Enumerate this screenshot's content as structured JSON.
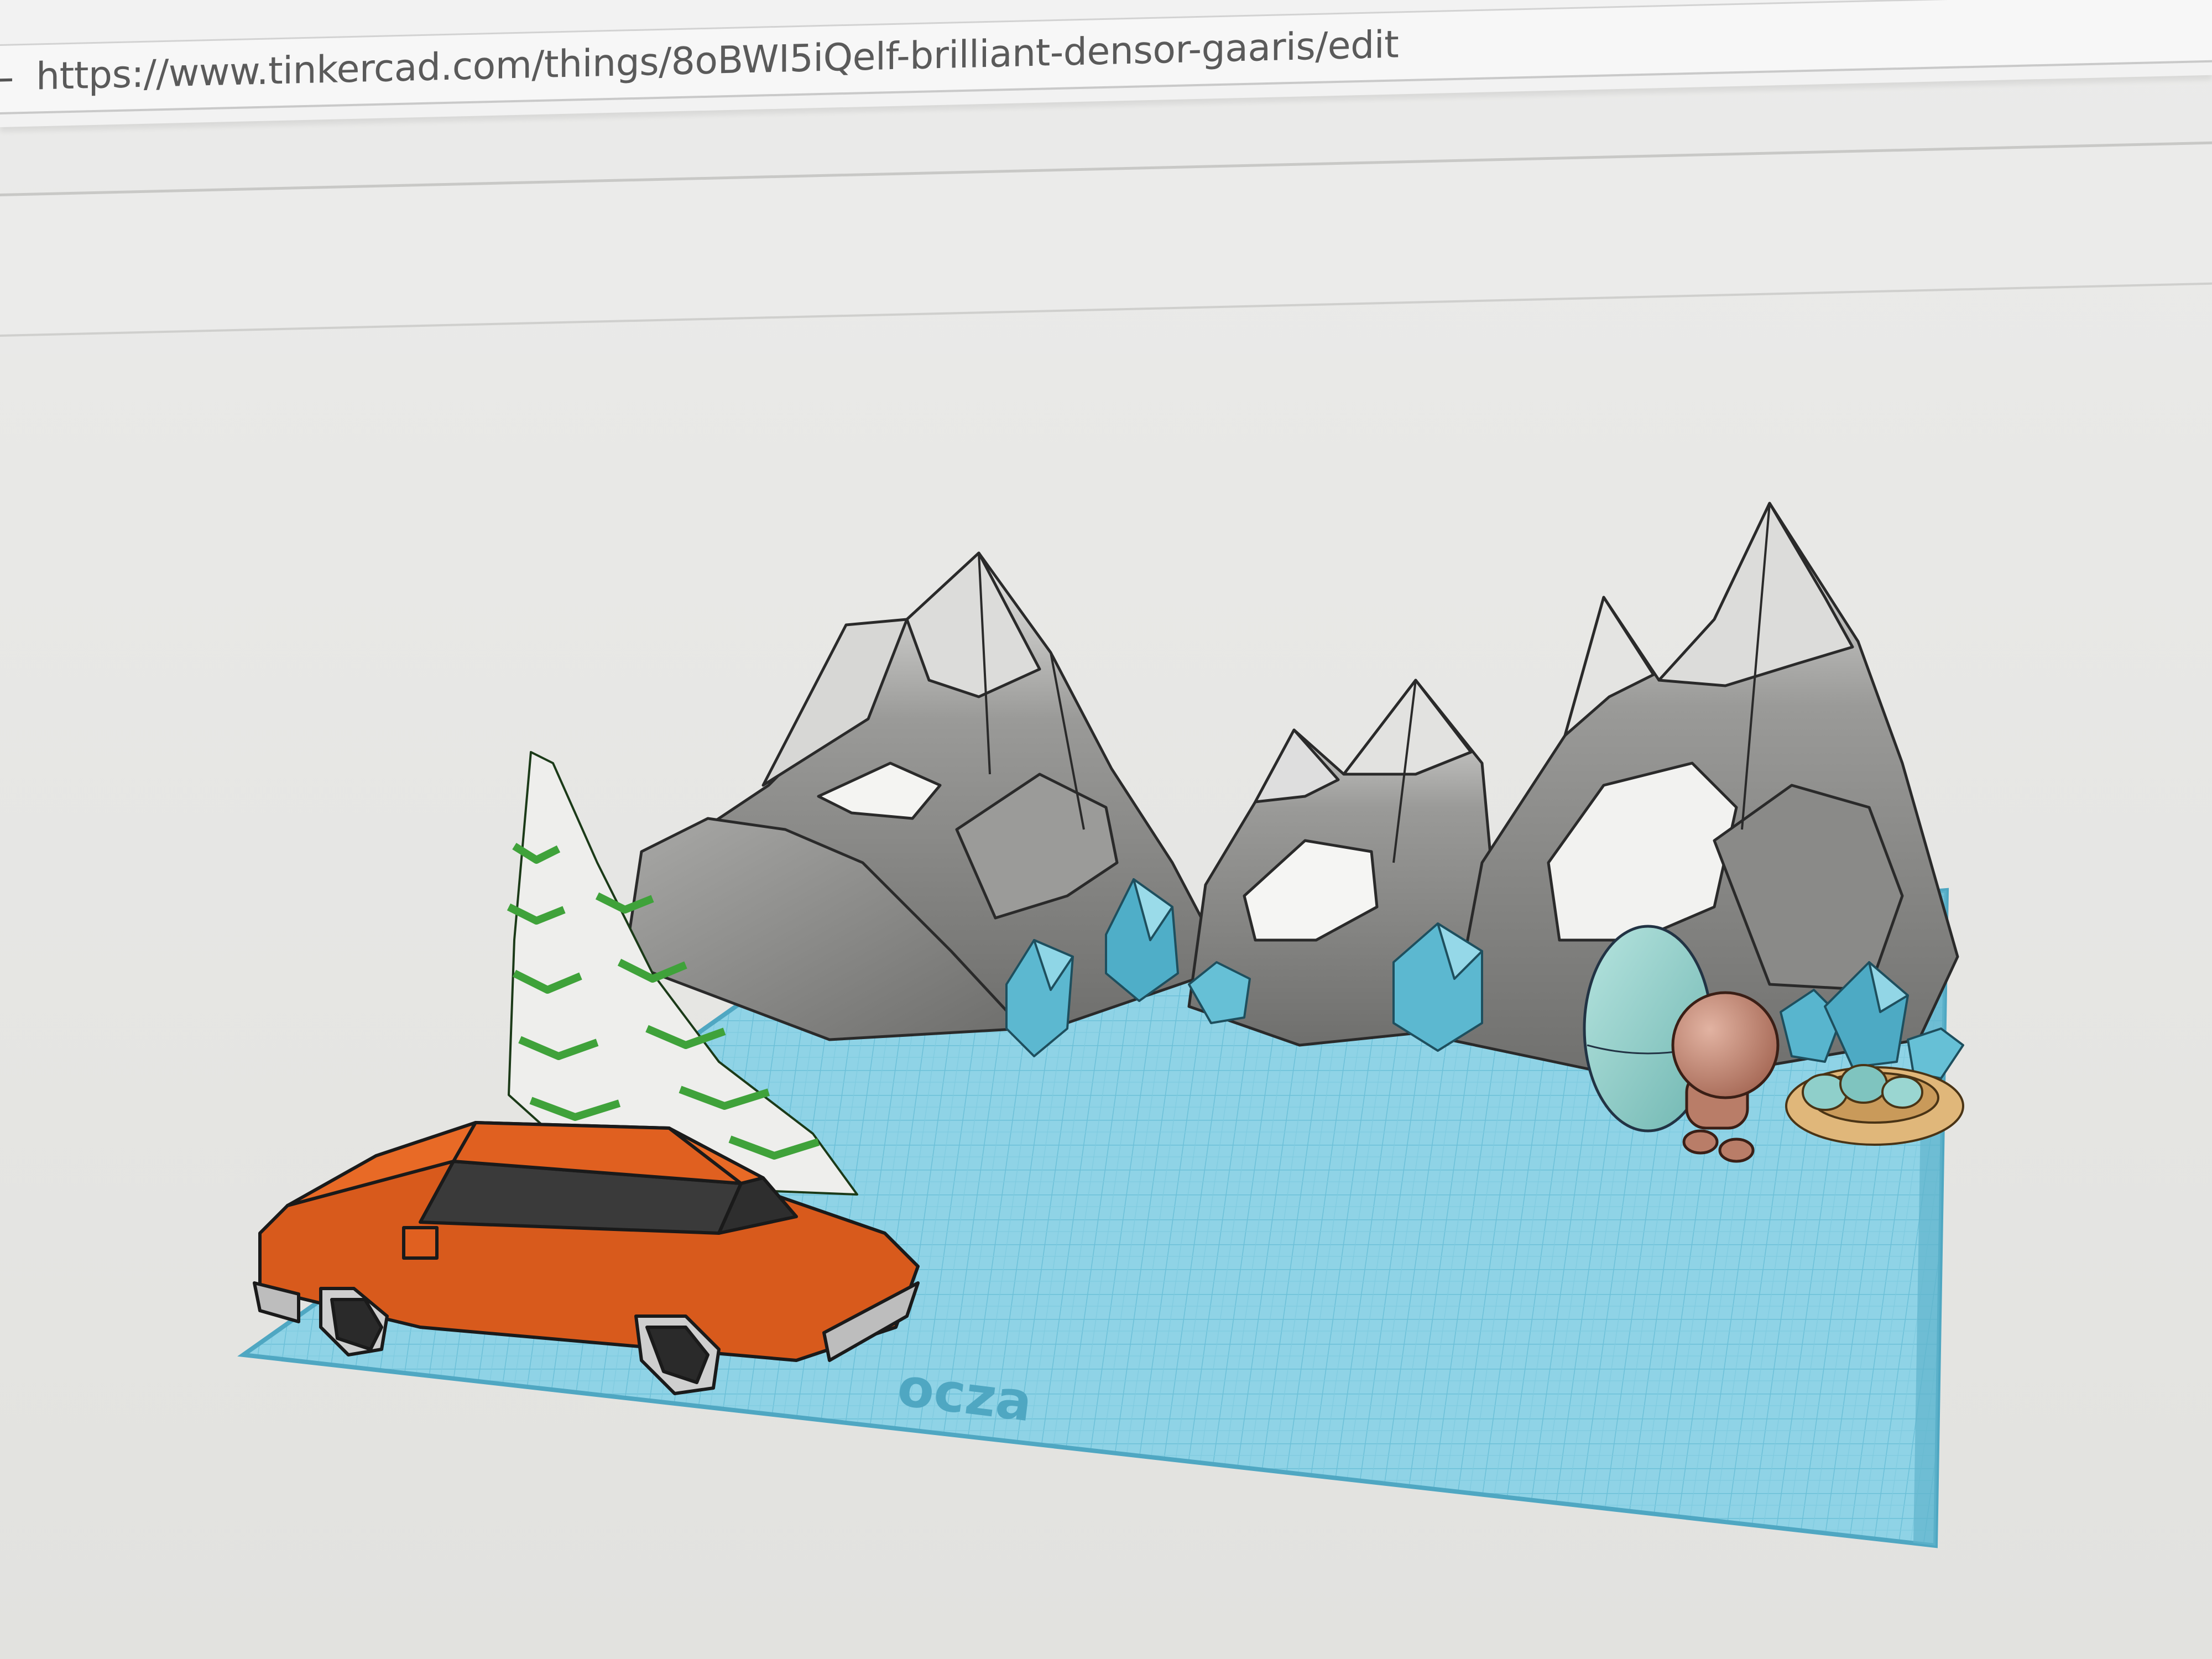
{
  "browser": {
    "url": "https://www.tinkercad.com/things/8oBWI5iQelf-brilliant-densor-gaaris/edit",
    "back_glyph": "←"
  },
  "workplane": {
    "watermark": "ocza",
    "grid_color": "#8fd3e6",
    "line_color": "#5fb4cc"
  },
  "models": [
    {
      "name": "pine-tree",
      "color": "#3fa23a"
    },
    {
      "name": "mountains",
      "color": "#8c8c8a"
    },
    {
      "name": "crystals",
      "color": "#5cb8d0"
    },
    {
      "name": "car",
      "color": "#e0621f"
    },
    {
      "name": "egg",
      "color": "#8fcfca"
    },
    {
      "name": "character",
      "color": "#c98f7a"
    },
    {
      "name": "nest",
      "color": "#e0b77a"
    }
  ]
}
